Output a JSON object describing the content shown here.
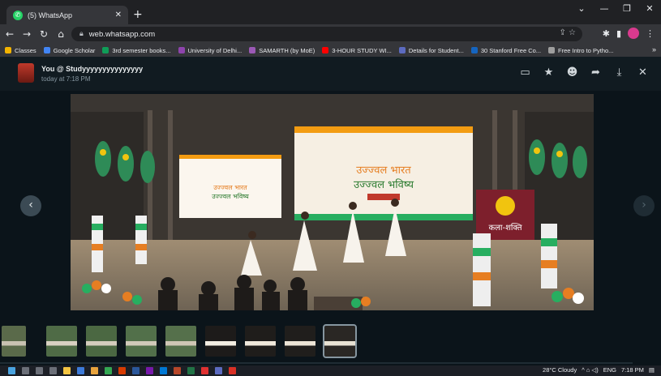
{
  "browser": {
    "tab_title": "(5) WhatsApp",
    "url": "web.whatsapp.com",
    "bookmarks": [
      {
        "label": "Classes",
        "color": "#f4b400"
      },
      {
        "label": "Google Scholar",
        "color": "#4285f4"
      },
      {
        "label": "3rd semester books...",
        "color": "#0f9d58"
      },
      {
        "label": "University of Delhi...",
        "color": "#8e44ad"
      },
      {
        "label": "SAMARTH (by MoE)",
        "color": "#9b59b6"
      },
      {
        "label": "3-HOUR STUDY WI...",
        "color": "#ff0000"
      },
      {
        "label": "Details for Student...",
        "color": "#5c6bc0"
      },
      {
        "label": "30 Stanford Free Co...",
        "color": "#1565c0"
      },
      {
        "label": "Free Intro to Pytho...",
        "color": "#9e9e9e"
      }
    ]
  },
  "viewer": {
    "sender": "You @ Studyyyyyyyyyyyyyyy",
    "time": "today at 7:18 PM",
    "header_icons": [
      "message-icon",
      "star-icon",
      "emoji-icon",
      "forward-icon",
      "download-icon",
      "close-icon"
    ]
  },
  "photo": {
    "banner_main_line1": "उज्ज्वल भारत",
    "banner_main_line2": "उज्ज्वल भविष्य",
    "banner_left_line1": "उज्ज्वल भारत",
    "banner_left_line2": "उज्ज्वल भविष्य",
    "side_banner": "कला-शक्ति"
  },
  "thumbnails": {
    "count": 9,
    "active_index": 8
  },
  "taskbar": {
    "weather": "28°C  Cloudy",
    "lang": "ENG",
    "clock": "7:18 PM"
  }
}
